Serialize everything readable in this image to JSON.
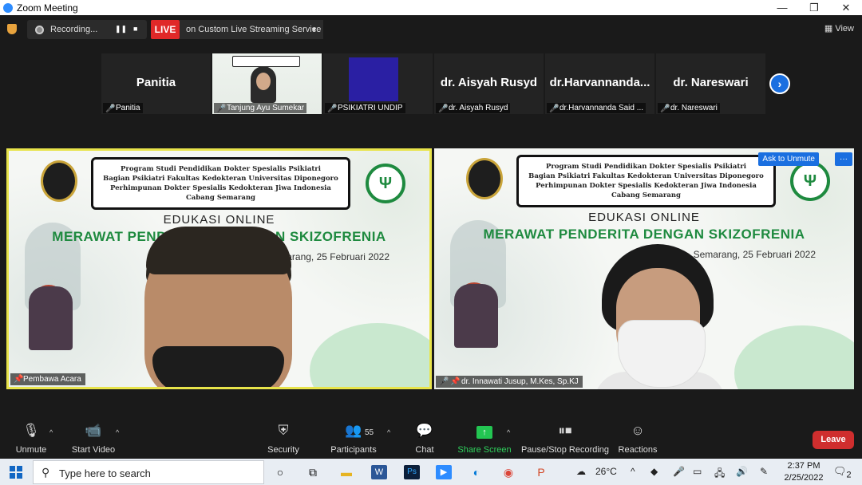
{
  "window": {
    "title": "Zoom Meeting",
    "controls": [
      "—",
      "❐",
      "✕"
    ]
  },
  "topbar": {
    "recording_label": "Recording...",
    "live_label": "LIVE",
    "live_service": "on Custom Live Streaming Service",
    "view_label": "View"
  },
  "gallery": [
    {
      "display": "Panitia",
      "label": "Panitia",
      "kind": "name"
    },
    {
      "display": "",
      "label": "Tanjung Ayu Sumekar",
      "kind": "video"
    },
    {
      "display": "",
      "label": "PSIKIATRI UNDIP",
      "kind": "purple"
    },
    {
      "display": "dr. Aisyah Rusyd",
      "label": "dr. Aisyah Rusyd",
      "kind": "name"
    },
    {
      "display": "dr.Harvannanda...",
      "label": "dr.Harvannanda Said ...",
      "kind": "name"
    },
    {
      "display": "dr. Nareswari",
      "label": "dr. Nareswari",
      "kind": "name"
    }
  ],
  "slide": {
    "header_lines": [
      "Program Studi Pendidikan Dokter Spesialis Psikiatri",
      "Bagian Psikiatri Fakultas Kedokteran Universitas Diponegoro",
      "Perhimpunan Dokter Spesialis Kedokteran Jiwa Indonesia",
      "Cabang Semarang"
    ],
    "left_line1": "EDUKASI ONLINE",
    "left_line2": "MERAWAT PENDER",
    "left_line2b": "GAN SKIZOFRENIA",
    "left_date": "Semarang, 25 Februari 2022",
    "right_line1": "EDUKASI ONLINE",
    "right_line2": "MERAWAT PENDERITA DENGAN SKIZOFRENIA",
    "right_date": "Semarang, 25 Februari 2022"
  },
  "videos": {
    "left_label": "Pembawa Acara",
    "right_label": "dr. Innawati Jusup, M.Kes, Sp.KJ",
    "ask_unmute": "Ask to Unmute",
    "more": "···"
  },
  "toolbar": {
    "unmute": "Unmute",
    "start_video": "Start Video",
    "security": "Security",
    "participants": "Participants",
    "participants_count": "55",
    "chat": "Chat",
    "share_screen": "Share Screen",
    "pause_stop_recording": "Pause/Stop Recording",
    "reactions": "Reactions",
    "leave": "Leave"
  },
  "taskbar": {
    "search_placeholder": "Type here to search",
    "weather": "26°C",
    "time": "2:37 PM",
    "date": "2/25/2022",
    "notifications": "2"
  },
  "colors": {
    "accent_blue": "#1a6fe0",
    "live_red": "#e02828",
    "leave_red": "#cf2e2e",
    "share_green": "#23c552",
    "active_speaker": "#e8e44a",
    "slide_green": "#1e8a3f"
  }
}
